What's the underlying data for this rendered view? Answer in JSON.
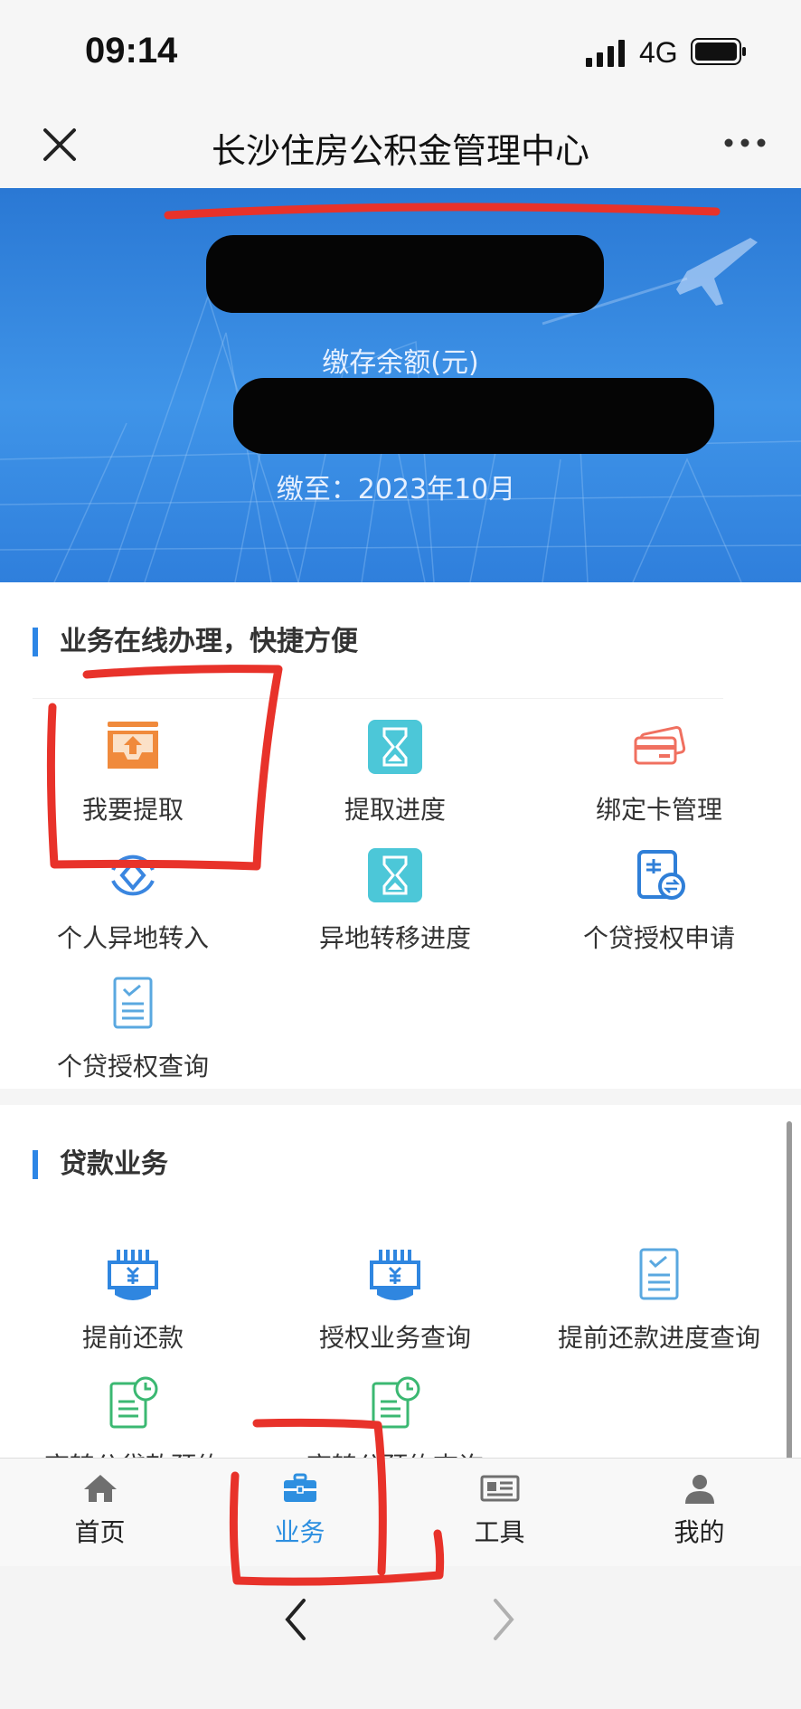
{
  "status_bar": {
    "time": "09:14",
    "network": "4G"
  },
  "nav": {
    "title": "长沙住房公积金管理中心"
  },
  "banner": {
    "balance_label": "缴存余额(元)",
    "paid_until": "缴至：2023年10月"
  },
  "online_section": {
    "title": "业务在线办理，快捷方便",
    "items": [
      {
        "label": "我要提取",
        "icon": "withdraw-tray-icon",
        "color": "#f08a3c"
      },
      {
        "label": "提取进度",
        "icon": "hourglass-icon",
        "color": "#4cc7d8"
      },
      {
        "label": "绑定卡管理",
        "icon": "bank-card-icon",
        "color": "#f07060"
      },
      {
        "label": "个人异地转入",
        "icon": "transfer-in-icon",
        "color": "#3a86e0"
      },
      {
        "label": "异地转移进度",
        "icon": "hourglass-icon",
        "color": "#4cc7d8"
      },
      {
        "label": "个贷授权申请",
        "icon": "loan-auth-icon",
        "color": "#2f7fd8"
      },
      {
        "label": "个贷授权查询",
        "icon": "document-check-icon",
        "color": "#5aa8e0"
      }
    ]
  },
  "loan_section": {
    "title": "贷款业务",
    "items": [
      {
        "label": "提前还款",
        "icon": "yuan-hand-icon",
        "color": "#2f86e0"
      },
      {
        "label": "授权业务查询",
        "icon": "yuan-hand-icon",
        "color": "#2f86e0"
      },
      {
        "label": "提前还款进度查询",
        "icon": "document-check-icon",
        "color": "#5aa8e0"
      },
      {
        "label": "商转公贷款预约",
        "icon": "document-clock-icon",
        "color": "#3bb872"
      },
      {
        "label": "商转公预约查询",
        "icon": "document-clock-icon",
        "color": "#3bb872"
      }
    ]
  },
  "tabbar": {
    "items": [
      {
        "label": "首页",
        "icon": "home-icon"
      },
      {
        "label": "业务",
        "icon": "briefcase-icon",
        "active": true
      },
      {
        "label": "工具",
        "icon": "newspaper-icon"
      },
      {
        "label": "我的",
        "icon": "user-icon"
      }
    ]
  },
  "colors": {
    "accent": "#2d86e6",
    "tab_active": "#2d8fe0",
    "banner": "#3a8ce4",
    "annotation": "#e8322a"
  }
}
